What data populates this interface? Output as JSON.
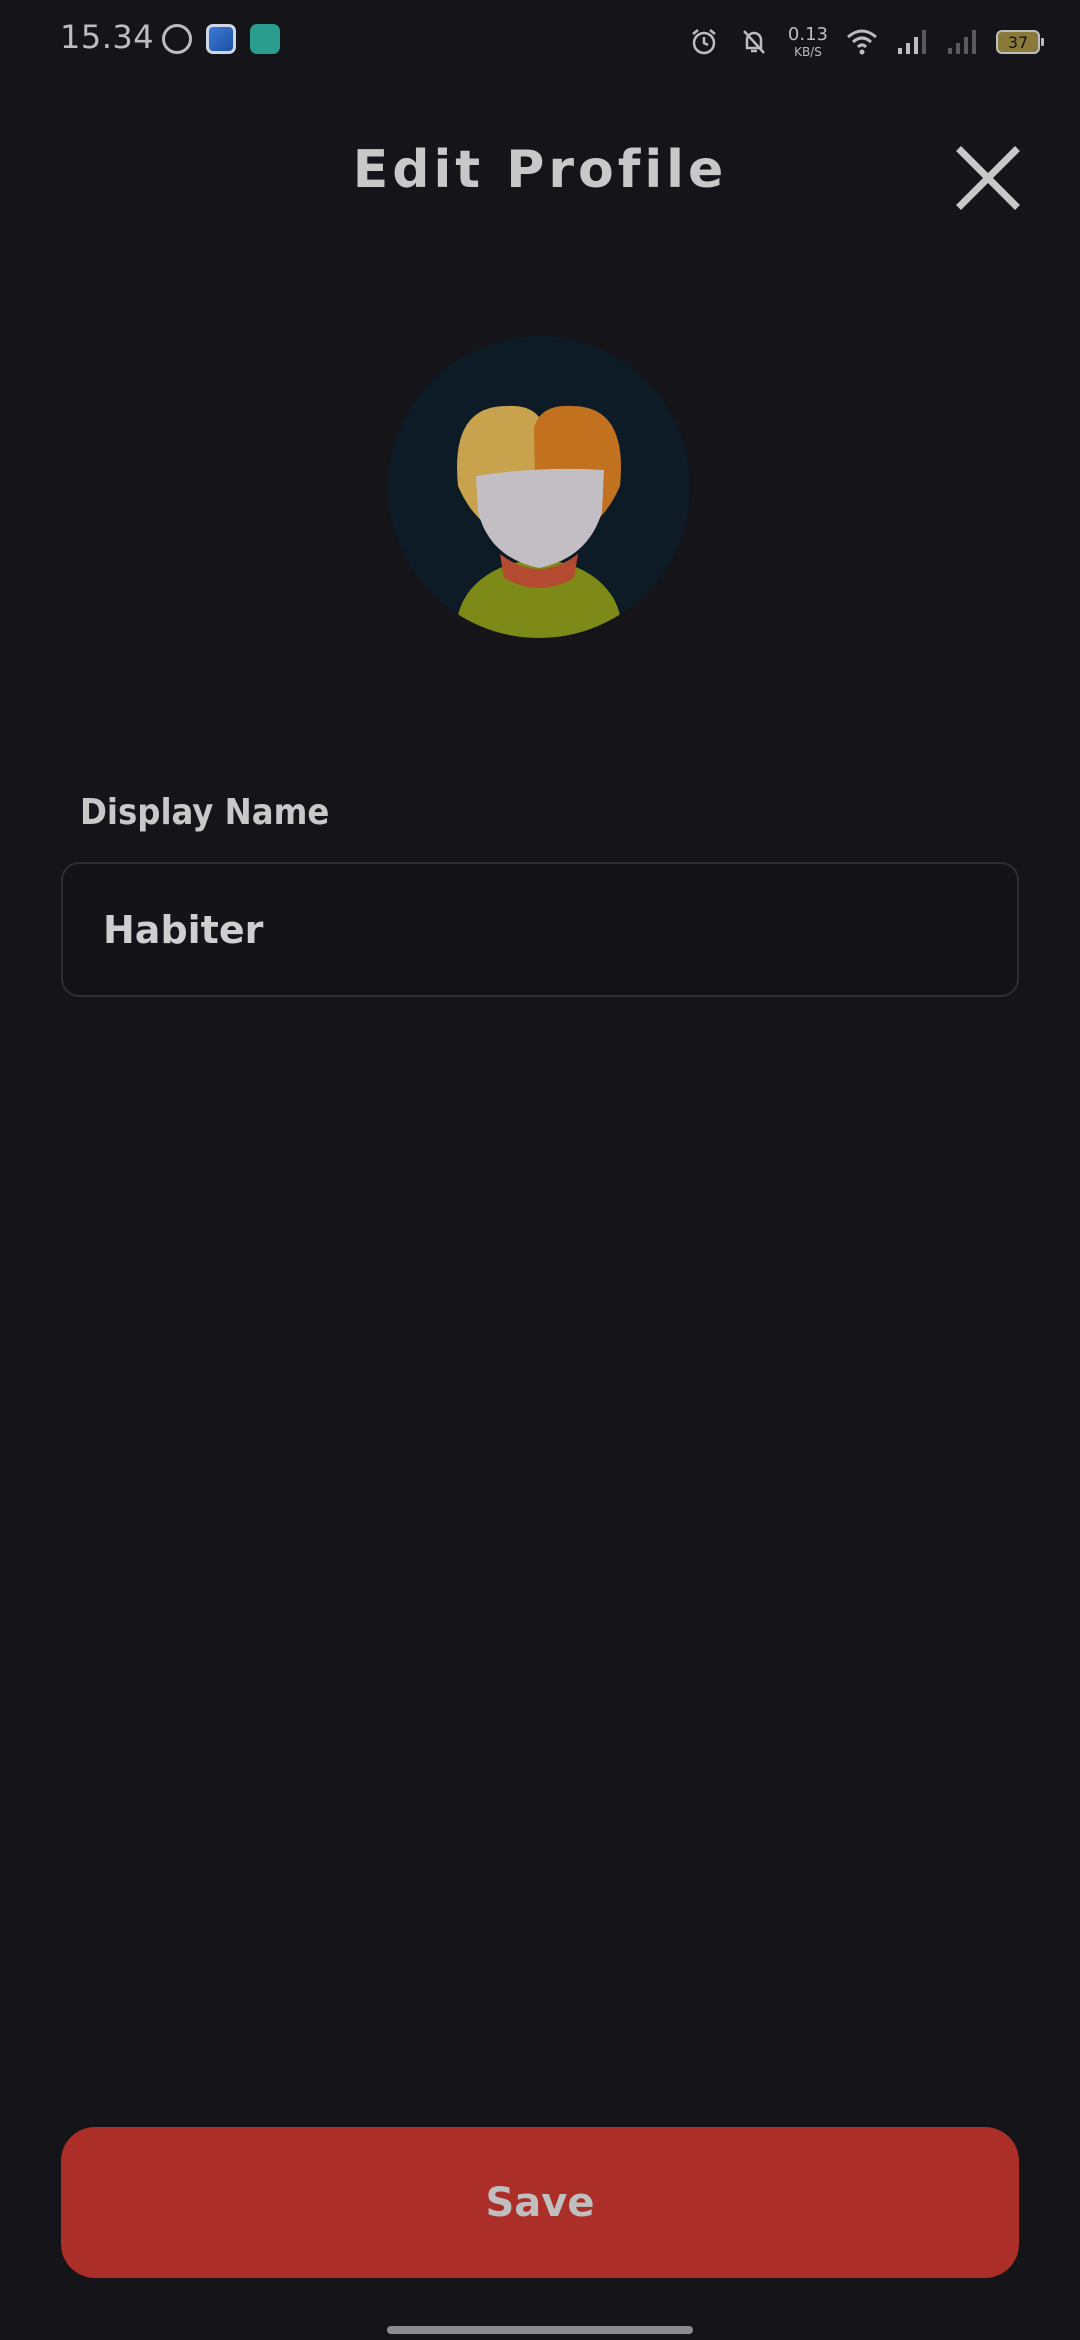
{
  "status_bar": {
    "time": "15.34",
    "net_speed_value": "0.13",
    "net_speed_unit": "KB/S",
    "battery_level": "37",
    "icons": [
      "whatsapp-icon",
      "app-icon",
      "app-icon",
      "alarm-icon",
      "bell-muted-icon",
      "wifi-icon",
      "signal-icon",
      "signal-icon",
      "battery-icon"
    ]
  },
  "header": {
    "title": "Edit Profile",
    "close_icon": "close-icon"
  },
  "form": {
    "display_name_label": "Display Name",
    "display_name_value": "Habiter"
  },
  "actions": {
    "save_label": "Save"
  },
  "colors": {
    "background": "#151418",
    "save_button": "#ab2e28",
    "text": "#c8c8c8",
    "avatar_bg": "#0c1b26"
  }
}
